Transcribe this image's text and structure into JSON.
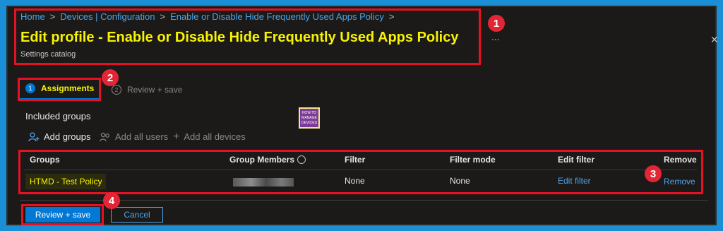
{
  "breadcrumb": {
    "items": [
      "Home",
      "Devices | Configuration",
      "Enable or Disable Hide Frequently Used Apps Policy"
    ],
    "separator": ">"
  },
  "header": {
    "title": "Edit profile - Enable or Disable Hide Frequently Used Apps Policy",
    "subtitle": "Settings catalog",
    "more_label": "...",
    "close_label": "✕"
  },
  "steps": [
    {
      "number": "1",
      "label": "Assignments"
    },
    {
      "number": "2",
      "label": "Review + save"
    }
  ],
  "assignments": {
    "section_label": "Included groups",
    "actions": {
      "add_groups": "Add groups",
      "add_all_users": "Add all users",
      "add_all_devices": "Add all devices"
    }
  },
  "logo": {
    "line1": "HOW TO",
    "line2": "MANAGE",
    "line3": "DEVICES"
  },
  "table": {
    "headers": [
      "Groups",
      "Group Members",
      "Filter",
      "Filter mode",
      "Edit filter",
      "Remove"
    ],
    "rows": [
      {
        "group": "HTMD - Test Policy",
        "members": "",
        "filter": "None",
        "filter_mode": "None",
        "edit_filter": "Edit filter",
        "remove": "Remove"
      }
    ]
  },
  "footer": {
    "primary_label": "Review + save",
    "secondary_label": "Cancel"
  },
  "markers": [
    "1",
    "2",
    "3",
    "4"
  ],
  "colors": {
    "accent": "#0078d4",
    "link": "#4fa3e8",
    "highlight_text": "#f8f300",
    "annotation_red": "#e81123",
    "background": "#1b1a19"
  }
}
